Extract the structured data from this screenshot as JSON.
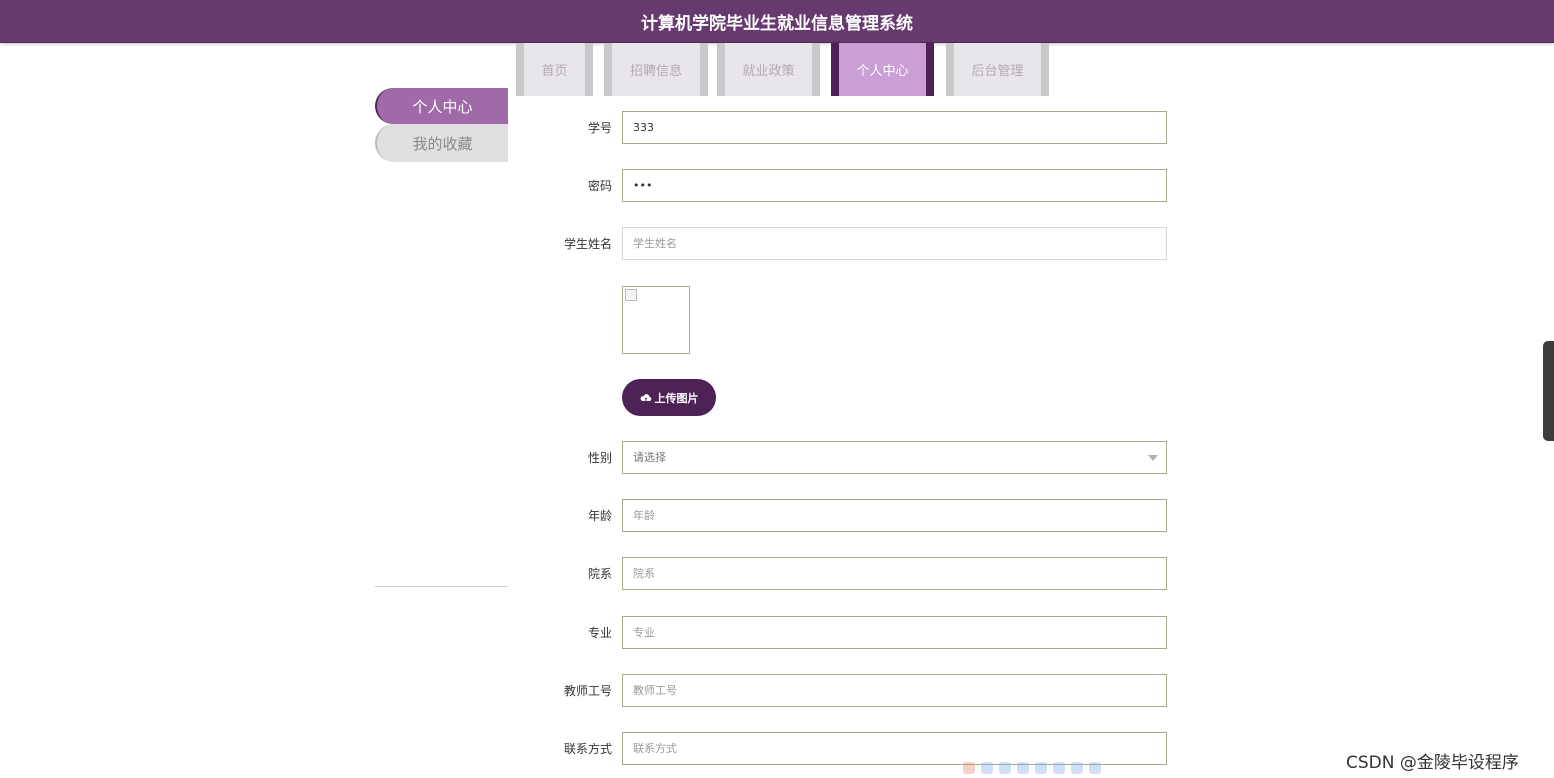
{
  "header": {
    "title": "计算机学院毕业生就业信息管理系统"
  },
  "nav": {
    "tabs": [
      {
        "label": "首页",
        "active": false
      },
      {
        "label": "招聘信息",
        "active": false
      },
      {
        "label": "就业政策",
        "active": false
      },
      {
        "label": "个人中心",
        "active": true
      },
      {
        "label": "后台管理",
        "active": false
      }
    ]
  },
  "sidebar": {
    "items": [
      {
        "label": "个人中心",
        "active": true
      },
      {
        "label": "我的收藏",
        "active": false
      }
    ]
  },
  "form": {
    "student_id": {
      "label": "学号",
      "value": "333"
    },
    "password": {
      "label": "密码",
      "value": "•••"
    },
    "student_name": {
      "label": "学生姓名",
      "placeholder": "学生姓名"
    },
    "upload_label": "上传图片",
    "gender": {
      "label": "性别",
      "selected": "请选择"
    },
    "age": {
      "label": "年龄",
      "placeholder": "年龄"
    },
    "department": {
      "label": "院系",
      "placeholder": "院系"
    },
    "major": {
      "label": "专业",
      "placeholder": "专业"
    },
    "teacher_id": {
      "label": "教师工号",
      "placeholder": "教师工号"
    },
    "contact": {
      "label": "联系方式",
      "placeholder": "联系方式"
    }
  },
  "watermark": "CSDN @金陵毕设程序",
  "colors": {
    "brand": "#663a6e",
    "accent_dark": "#4d2256",
    "active_tab": "#c99fd6",
    "sidebar_active": "#9f6aa7"
  }
}
